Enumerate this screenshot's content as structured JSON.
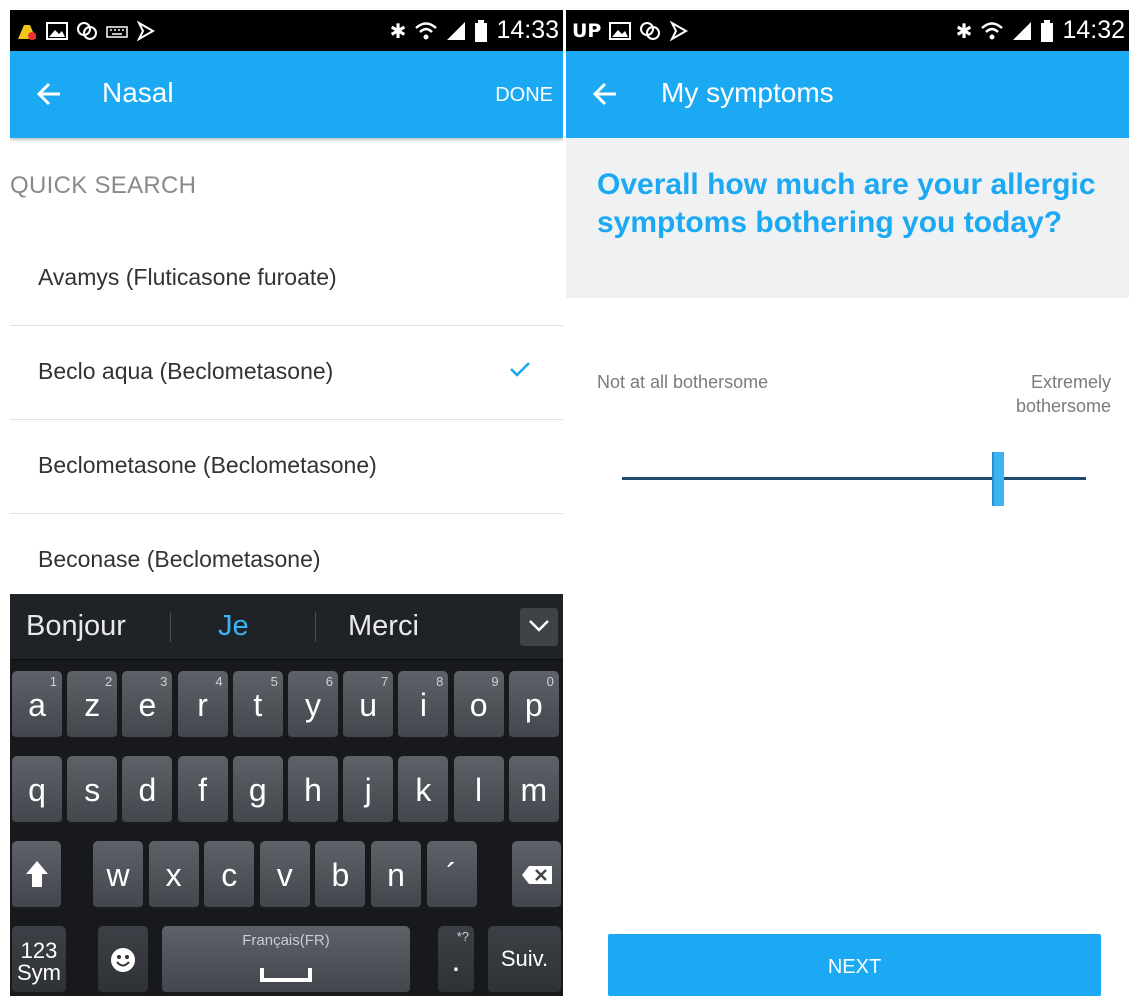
{
  "left": {
    "status_bar": {
      "time": "14:33",
      "icons": [
        "notification-app-icon",
        "gallery-icon",
        "sync-icon",
        "keyboard-icon",
        "flag-icon",
        "bluetooth-icon",
        "wifi-icon",
        "signal-icon",
        "battery-icon"
      ]
    },
    "app_bar": {
      "title": "Nasal",
      "action": "DONE"
    },
    "section_title": "QUICK SEARCH",
    "items": [
      {
        "label": "Avamys (Fluticasone furoate)",
        "checked": false
      },
      {
        "label": "Beclo aqua (Beclometasone)",
        "checked": true
      },
      {
        "label": "Beclometasone (Beclometasone)",
        "checked": false
      },
      {
        "label": "Beconase (Beclometasone)",
        "checked": false
      }
    ],
    "keyboard": {
      "suggestions": [
        "Bonjour",
        "Je",
        "Merci"
      ],
      "row1": [
        {
          "ch": "a",
          "sup": "1"
        },
        {
          "ch": "z",
          "sup": "2"
        },
        {
          "ch": "e",
          "sup": "3"
        },
        {
          "ch": "r",
          "sup": "4"
        },
        {
          "ch": "t",
          "sup": "5"
        },
        {
          "ch": "y",
          "sup": "6"
        },
        {
          "ch": "u",
          "sup": "7"
        },
        {
          "ch": "i",
          "sup": "8"
        },
        {
          "ch": "o",
          "sup": "9"
        },
        {
          "ch": "p",
          "sup": "0"
        }
      ],
      "row2": [
        "q",
        "s",
        "d",
        "f",
        "g",
        "h",
        "j",
        "k",
        "l",
        "m"
      ],
      "row3": [
        "w",
        "x",
        "c",
        "v",
        "b",
        "n",
        "´"
      ],
      "sym_key": [
        "123",
        "Sym"
      ],
      "space_label": "Français(FR)",
      "dot_key": ".",
      "dot_sup": "*?",
      "next_key": "Suiv."
    }
  },
  "right": {
    "status_bar": {
      "time": "14:32",
      "carrier": "UP",
      "icons": [
        "gallery-icon",
        "sync-icon",
        "flag-icon",
        "bluetooth-icon",
        "wifi-icon",
        "signal-icon",
        "battery-icon"
      ]
    },
    "app_bar": {
      "title": "My symptoms"
    },
    "question": "Overall how much are your allergic symptoms bothering you today?",
    "slider": {
      "min_label": "Not at all bothersome",
      "max_label": "Extremely bothersome",
      "value_fraction": 0.81
    },
    "next_button": "NEXT",
    "colors": {
      "accent": "#1aa9f2",
      "track": "#1f4b70",
      "thumb": "#3fb3ef"
    }
  }
}
